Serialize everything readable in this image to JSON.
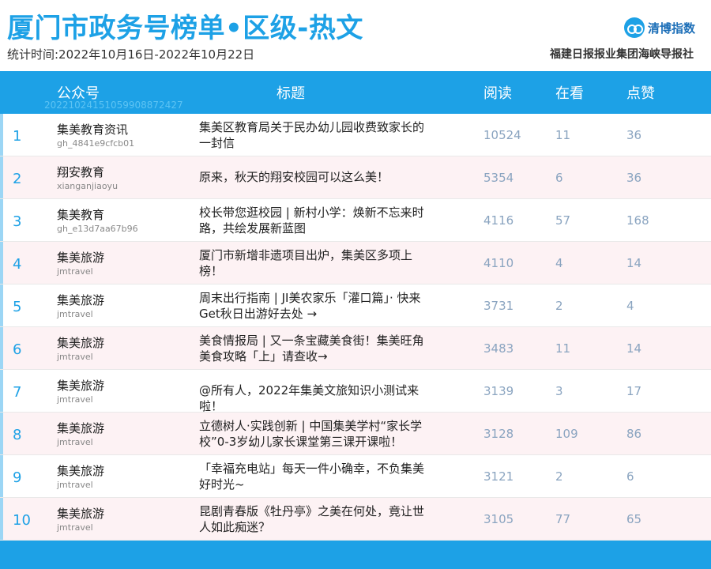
{
  "header": {
    "title": "厦门市政务号榜单•区级-热文",
    "period": "统计时间:2022年10月16日-2022年10月22日",
    "brand_name": "清博指数",
    "publisher": "福建日报报业集团海峡导报社"
  },
  "table": {
    "columns": {
      "account": "公众号",
      "title": "标题",
      "read": "阅读",
      "watch": "在看",
      "like": "点赞"
    },
    "watermark": "20221024151059908872427",
    "rows": [
      {
        "rank": "1",
        "account": "集美教育资讯",
        "account_id": "gh_4841e9cfcb01",
        "title": "集美区教育局关于民办幼儿园收费致家长的一封信",
        "read": "10524",
        "watch": "11",
        "like": "36"
      },
      {
        "rank": "2",
        "account": "翔安教育",
        "account_id": "xianganjiaoyu",
        "title": "原来，秋天的翔安校园可以这么美！",
        "read": "5354",
        "watch": "6",
        "like": "36"
      },
      {
        "rank": "3",
        "account": "集美教育",
        "account_id": "gh_e13d7aa67b96",
        "title": "校长带您逛校园 | 新村小学：焕新不忘来时路，共绘发展新蓝图",
        "read": "4116",
        "watch": "57",
        "like": "168"
      },
      {
        "rank": "4",
        "account": "集美旅游",
        "account_id": "jmtravel",
        "title": "厦门市新增非遗项目出炉，集美区多项上榜！",
        "read": "4110",
        "watch": "4",
        "like": "14"
      },
      {
        "rank": "5",
        "account": "集美旅游",
        "account_id": "jmtravel",
        "title": "周末出行指南 | JI美农家乐「灌口篇」· 快来Get秋日出游好去处 →",
        "read": "3731",
        "watch": "2",
        "like": "4"
      },
      {
        "rank": "6",
        "account": "集美旅游",
        "account_id": "jmtravel",
        "title": "美食情报局 | 又一条宝藏美食街！集美旺角美食攻略「上」请查收→",
        "read": "3483",
        "watch": "11",
        "like": "14"
      },
      {
        "rank": "7",
        "account": "集美旅游",
        "account_id": "jmtravel",
        "title": "@所有人，2022年集美文旅知识小测试来啦！",
        "read": "3139",
        "watch": "3",
        "like": "17"
      },
      {
        "rank": "8",
        "account": "集美旅游",
        "account_id": "jmtravel",
        "title": "立德树人·实践创新 | 中国集美学村“家长学校”0-3岁幼儿家长课堂第三课开课啦！",
        "read": "3128",
        "watch": "109",
        "like": "86"
      },
      {
        "rank": "9",
        "account": "集美旅游",
        "account_id": "jmtravel",
        "title": "「幸福充电站」每天一件小确幸，不负集美好时光~",
        "read": "3121",
        "watch": "2",
        "like": "6"
      },
      {
        "rank": "10",
        "account": "集美旅游",
        "account_id": "jmtravel",
        "title": "昆剧青春版《牡丹亭》之美在何处，竟让世人如此痴迷？",
        "read": "3105",
        "watch": "77",
        "like": "65"
      }
    ]
  },
  "colors": {
    "accent": "#1da1e6",
    "row_alt": "#fdf2f4",
    "numbers": "#8aa4c0"
  }
}
